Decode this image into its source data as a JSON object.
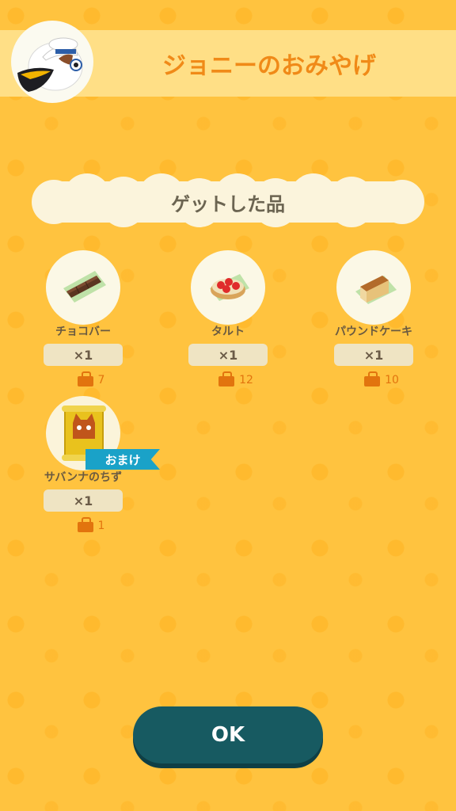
{
  "header": {
    "title": "ジョニーのおみやげ",
    "avatar_icon": "pelican-sailor-icon"
  },
  "section": {
    "title": "ゲットした品"
  },
  "items": [
    {
      "name": "チョコバー",
      "quantity": "×1",
      "price": "7",
      "icon": "chocolate-bar-icon"
    },
    {
      "name": "タルト",
      "quantity": "×1",
      "price": "12",
      "icon": "strawberry-tart-icon"
    },
    {
      "name": "パウンドケーキ",
      "quantity": "×1",
      "price": "10",
      "icon": "pound-cake-icon"
    },
    {
      "name": "サバンナのちず",
      "quantity": "×1",
      "price": "1",
      "icon": "map-scroll-icon",
      "badge": "おまけ"
    }
  ],
  "ok_button": {
    "label": "OK"
  },
  "colors": {
    "background": "#ffc33f",
    "header_band": "#ffdf86",
    "title": "#f08a18",
    "badge": "#1aa2c8",
    "ok_button": "#175a61"
  }
}
